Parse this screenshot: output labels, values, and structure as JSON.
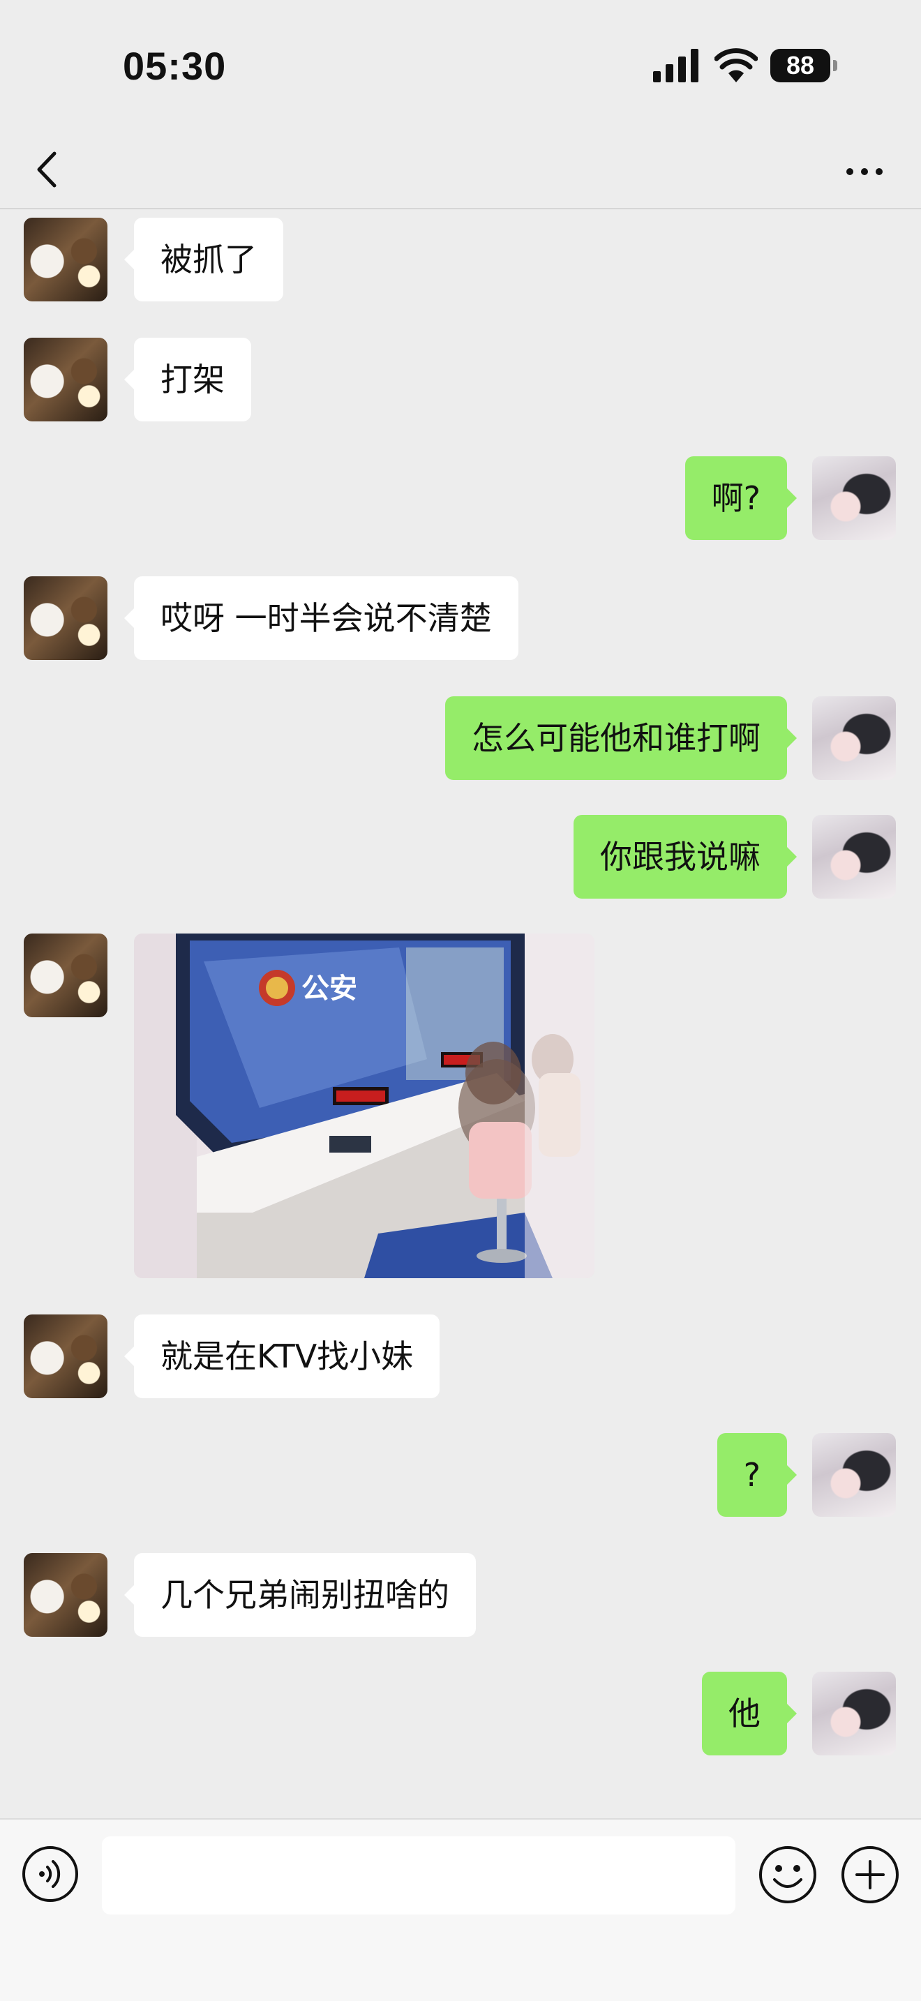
{
  "status_bar": {
    "time": "05:30",
    "battery_level": "88",
    "icons": [
      "signal-icon",
      "wifi-icon",
      "battery-icon"
    ]
  },
  "nav": {
    "back_icon": "chevron-left-icon",
    "more_icon": "more-dots-icon"
  },
  "messages": [
    {
      "side": "left",
      "type": "text",
      "text": "被抓了"
    },
    {
      "side": "left",
      "type": "text",
      "text": "打架"
    },
    {
      "side": "right",
      "type": "text",
      "text": "啊?"
    },
    {
      "side": "left",
      "type": "text",
      "text": "哎呀 一时半会说不清楚"
    },
    {
      "side": "right",
      "type": "text",
      "text": "怎么可能他和谁打啊"
    },
    {
      "side": "right",
      "type": "text",
      "text": "你跟我说嘛"
    },
    {
      "side": "left",
      "type": "image",
      "sign_text": "公安"
    },
    {
      "side": "left",
      "type": "text",
      "text": "就是在KTV找小妹"
    },
    {
      "side": "right",
      "type": "text",
      "text": "?"
    },
    {
      "side": "left",
      "type": "text",
      "text": "几个兄弟闹别扭啥的"
    },
    {
      "side": "right",
      "type": "text",
      "text": "他"
    }
  ],
  "input_bar": {
    "voice_icon": "voice-icon",
    "emoji_icon": "emoji-icon",
    "plus_icon": "plus-icon",
    "input_value": ""
  },
  "colors": {
    "background": "#ededed",
    "bubble_sent": "#95ec69",
    "bubble_received": "#ffffff",
    "text": "#111111"
  }
}
